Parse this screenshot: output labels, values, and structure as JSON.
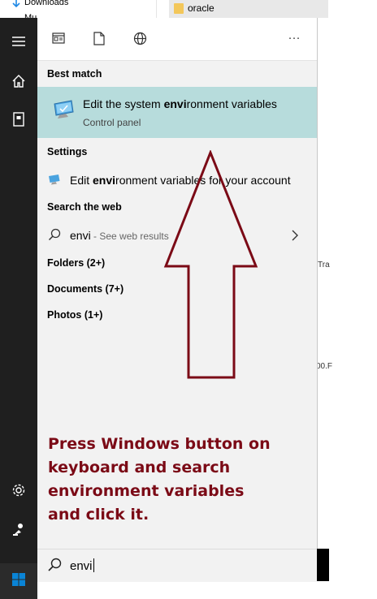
{
  "explorer": {
    "nav_downloads": "Downloads",
    "nav_music_partial": "Mu",
    "folder_name": "oracle",
    "fragments": [
      "Tra",
      "00.F"
    ]
  },
  "start_rail": {
    "icons": [
      "hamburger-icon",
      "home-icon",
      "notebook-icon",
      "settings-icon",
      "feedback-icon",
      "windows-logo-icon"
    ]
  },
  "topbar": {
    "filters": [
      "apps-icon",
      "documents-icon",
      "web-icon"
    ],
    "more": "···"
  },
  "sections": {
    "best_match": "Best match",
    "settings": "Settings",
    "search_web": "Search the web"
  },
  "best_match": {
    "title_pre": "Edit the system ",
    "title_bold": "envi",
    "title_post": "ronment variables",
    "subtitle": "Control panel"
  },
  "settings_item": {
    "pre": "Edit ",
    "bold": "envi",
    "post": "ronment variables for your account"
  },
  "web_item": {
    "query": "envi",
    "hint": " - See web results"
  },
  "categories": [
    "Folders (2+)",
    "Documents (7+)",
    "Photos (1+)"
  ],
  "search": {
    "value": "envi"
  },
  "annotation": {
    "lines": [
      "Press Windows button on",
      "keyboard and search",
      "environment variables",
      "and click it."
    ],
    "color": "#7b0a16"
  },
  "colors": {
    "highlight": "#b7dcdc",
    "rail": "#1f1f1f",
    "panel": "#f2f2f2",
    "windows_blue": "#0a84d6"
  }
}
